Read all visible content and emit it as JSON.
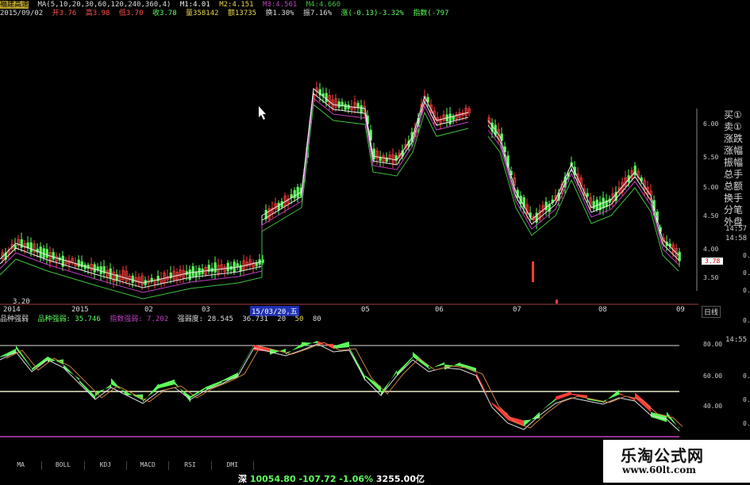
{
  "header": {
    "stock_name": "福建高速",
    "ma_line": [
      "MA(5,10,20,30,60,120,240,360,4)",
      "M1:4.01",
      "M2:4.151",
      "M3:4.561",
      "M4:4.660"
    ],
    "quote_line": [
      "2015/09/02",
      "开3.76",
      "高3.98",
      "低3.70",
      "收3.78",
      "量358142",
      "额13735",
      "换1.30%",
      "振7.16%",
      "涨(-0.13)-3.32%",
      "指数(-797"
    ]
  },
  "main_chart": {
    "price_labels": [
      "6.00",
      "5.50",
      "5.00",
      "4.50",
      "4.00",
      "3.50"
    ],
    "time_labels": [
      "2014",
      "2015",
      "02",
      "03",
      "15/03/20,五",
      "05",
      "06",
      "07",
      "08",
      "09"
    ],
    "low_marker": "3.20",
    "current_price": "3.78",
    "period_button": "日线"
  },
  "indicator": {
    "header": [
      "品种强弱",
      "品种强弱: 35.746",
      "指数强弱: 7.202",
      "强弱度: 28.545",
      "36.731",
      "20",
      "50",
      "80"
    ],
    "levels": [
      "80.00",
      "60.00",
      "40.00"
    ]
  },
  "right_panel": {
    "items": [
      "买①",
      "卖①",
      "涨跌",
      "涨幅",
      "振幅",
      "总手",
      "总额",
      "换手",
      "分笔",
      "外盘"
    ],
    "times": [
      "14:57",
      "14:58"
    ]
  },
  "right_edge_numbers": [
    "0.",
    "0.",
    "0.",
    "0.",
    "14:55",
    "0.",
    "0.",
    "0."
  ],
  "tabs": [
    "MA",
    "BOLL",
    "KDJ",
    "MACD",
    "RSI",
    "DMI"
  ],
  "status_bar": {
    "market": "深",
    "index": "10054.80",
    "change": "-107.72",
    "pct": "-1.06%",
    "amount": "3255.00亿"
  },
  "watermark": {
    "title": "乐淘公式网",
    "url": "www.60lt.com"
  },
  "colors": {
    "up": "#ff3c3c",
    "down": "#5cff5c",
    "ma_white": "#e8e8e8",
    "ma_magenta": "#c040c0",
    "ma_green": "#40c040",
    "yellow": "#e8d84a",
    "cyan": "#40d0e0"
  }
}
